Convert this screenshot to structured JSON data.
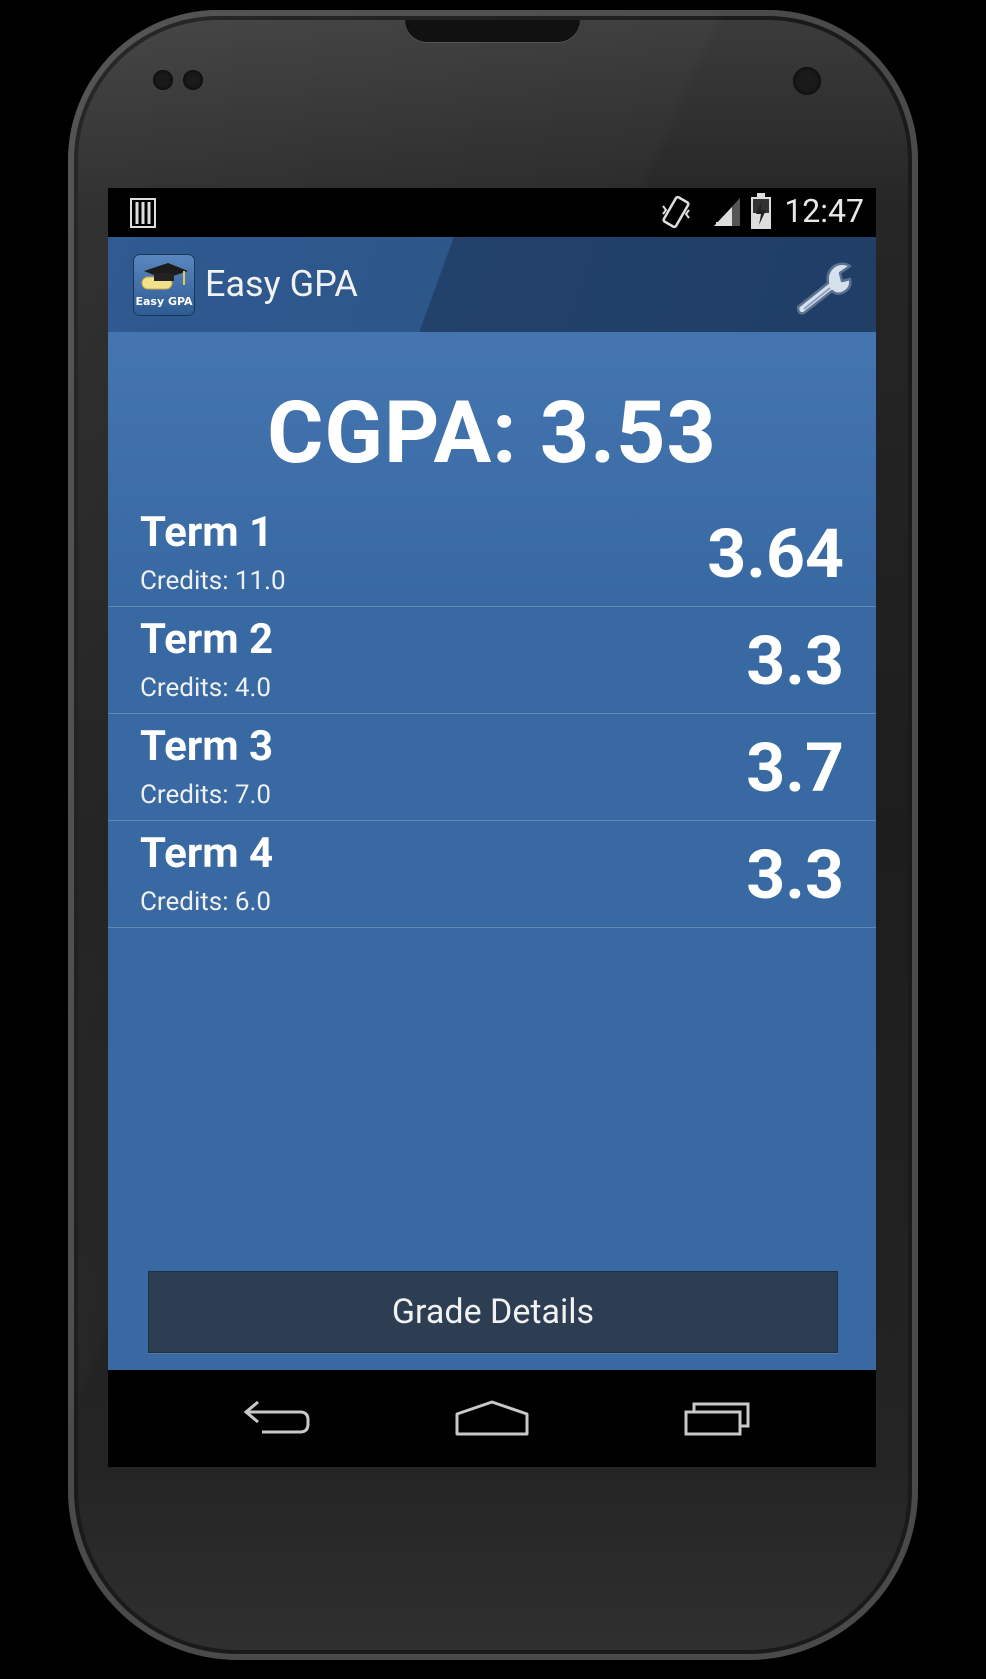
{
  "status_bar": {
    "time": "12:47",
    "icons": [
      "notification-icon",
      "vibrate-icon",
      "signal-icon",
      "battery-charging-icon"
    ]
  },
  "action_bar": {
    "app_icon_text": "Easy GPA",
    "title": "Easy GPA",
    "settings_icon": "wrench-icon"
  },
  "summary": {
    "cgpa_text": "CGPA: 3.53"
  },
  "terms": [
    {
      "name": "Term 1",
      "credits": "Credits: 11.0",
      "gpa": "3.64"
    },
    {
      "name": "Term 2",
      "credits": "Credits: 4.0",
      "gpa": "3.3"
    },
    {
      "name": "Term 3",
      "credits": "Credits: 7.0",
      "gpa": "3.7"
    },
    {
      "name": "Term 4",
      "credits": "Credits: 6.0",
      "gpa": "3.3"
    }
  ],
  "grade_details_label": "Grade Details",
  "nav_bar": {
    "icons": [
      "back-icon",
      "home-icon",
      "recent-apps-icon"
    ]
  },
  "colors": {
    "content_bg": "#3869a3",
    "action_bar_bg": "#2d5689",
    "button_bg": "#2d3d52"
  }
}
